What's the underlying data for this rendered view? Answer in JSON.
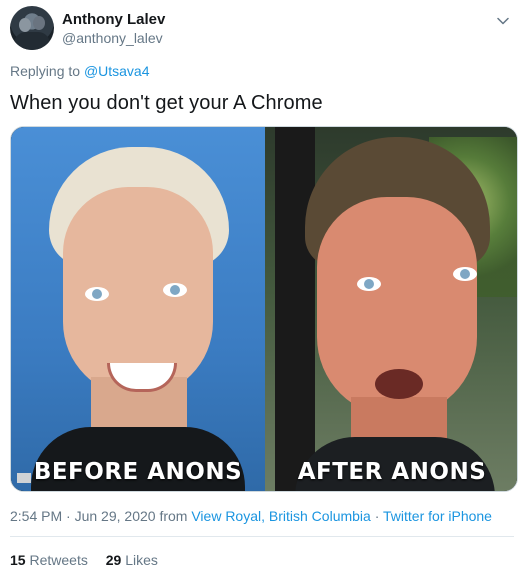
{
  "author": {
    "name": "Anthony Lalev",
    "handle": "@anthony_lalev"
  },
  "reply": {
    "prefix": "Replying to",
    "mention": "@Utsava4"
  },
  "tweet": {
    "text": "When you don't get your A Chrome"
  },
  "media": {
    "left_caption": "BEFORE ANONS",
    "right_caption": "AFTER ANONS"
  },
  "meta": {
    "time": "2:54 PM",
    "sep1": "·",
    "date": "Jun 29, 2020",
    "from_word": "from",
    "location": "View Royal, British Columbia",
    "sep2": "·",
    "client": "Twitter for iPhone"
  },
  "stats": {
    "retweets_count": "15",
    "retweets_label": "Retweets",
    "likes_count": "29",
    "likes_label": "Likes"
  },
  "icons": {
    "menu": "chevron-down-icon"
  },
  "colors": {
    "link": "#1b95e0",
    "secondary": "#657786",
    "primary": "#14171a"
  }
}
